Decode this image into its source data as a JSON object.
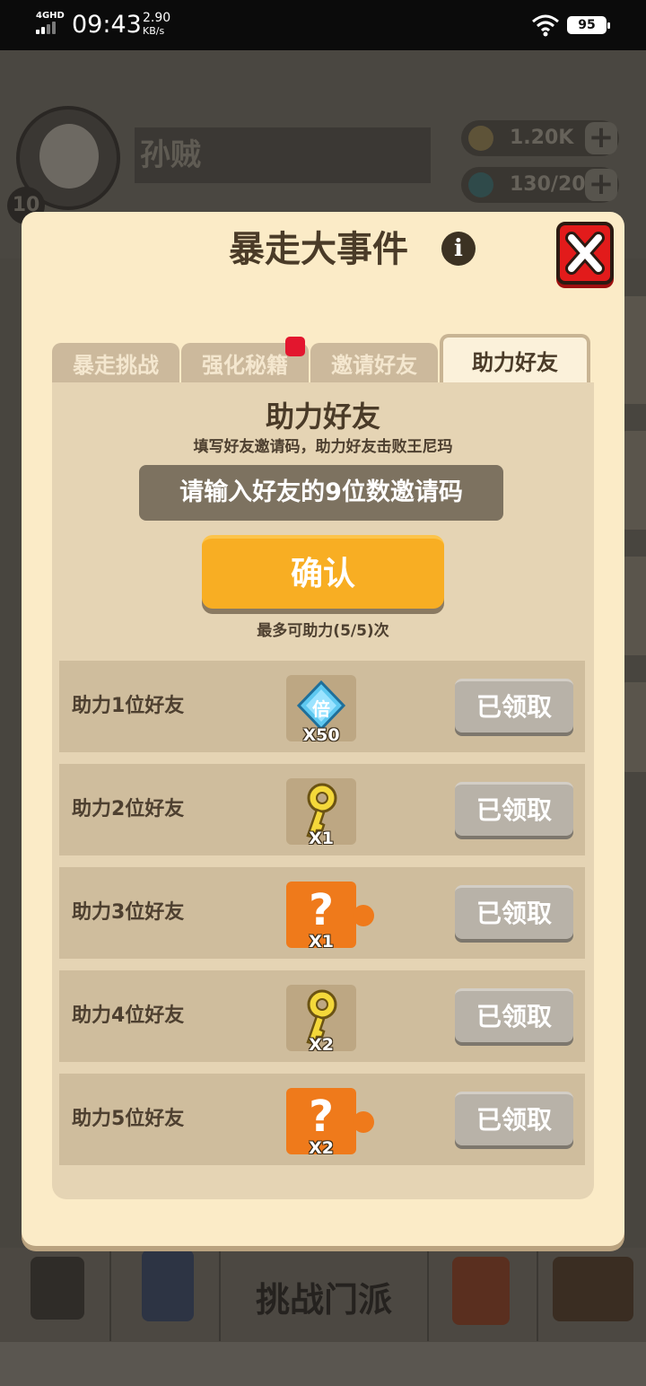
{
  "status_bar": {
    "network": "4GHD",
    "time": "09:43",
    "speed_value": "2.90",
    "speed_unit": "KB/s",
    "battery": "95"
  },
  "background": {
    "player_name": "孙贼",
    "level": "10",
    "coins": "1.20K",
    "energy": "130/20",
    "bottom_nav_main": "挑战门派"
  },
  "modal": {
    "title": "暴走大事件",
    "info_icon": "info-icon",
    "close_icon": "close-icon",
    "tabs": [
      {
        "label": "暴走挑战",
        "active": false
      },
      {
        "label": "强化秘籍",
        "active": false,
        "has_red_dot": true
      },
      {
        "label": "邀请好友",
        "active": false
      },
      {
        "label": "助力好友",
        "active": true
      }
    ],
    "panel": {
      "title": "助力好友",
      "subtitle": "填写好友邀请码，助力好友击败王尼玛",
      "code_input_placeholder": "请输入好友的9位数邀请码",
      "confirm_label": "确认",
      "remaining_text": "最多可助力(5/5)次"
    },
    "rewards": [
      {
        "label": "助力1位好友",
        "item": "diamond-multiplier-icon",
        "item_glyph": "倍",
        "count": "X50",
        "button": "已领取"
      },
      {
        "label": "助力2位好友",
        "item": "key-icon",
        "count": "X1",
        "button": "已领取"
      },
      {
        "label": "助力3位好友",
        "item": "mystery-puzzle-icon",
        "count": "X1",
        "button": "已领取"
      },
      {
        "label": "助力4位好友",
        "item": "key-icon",
        "count": "X2",
        "button": "已领取"
      },
      {
        "label": "助力5位好友",
        "item": "mystery-puzzle-icon",
        "count": "X2",
        "button": "已领取"
      }
    ]
  },
  "colors": {
    "modal_bg": "#fbebc7",
    "panel_bg": "#e5d4b4",
    "row_bg": "#cfbd9d",
    "confirm": "#f8ae23",
    "claimed": "#b8b2a8",
    "close": "#e21b1b"
  }
}
